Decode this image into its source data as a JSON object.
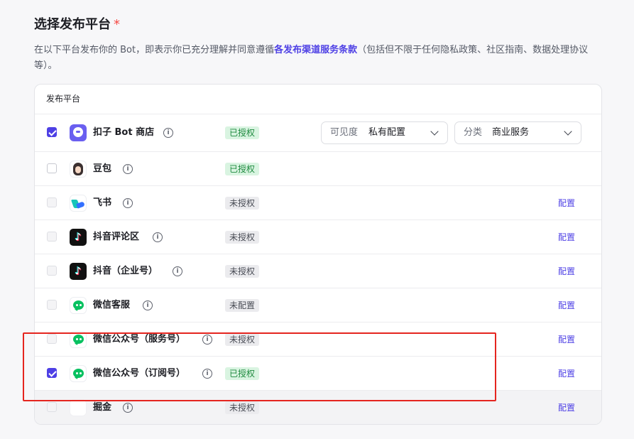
{
  "title": "选择发布平台",
  "required_mark": "*",
  "description": {
    "before": "在以下平台发布你的 Bot，即表示你已充分理解并同意遵循",
    "link": "各发布渠道服务条款",
    "after": "（包括但不限于任何隐私政策、社区指南、数据处理协议等）。"
  },
  "table": {
    "header": "发布平台",
    "rows": [
      {
        "name": "扣子 Bot 商店",
        "logo": "kouzi-logo",
        "checked": true,
        "status": "已授权"
      },
      {
        "name": "豆包",
        "logo": "doubao-logo",
        "checked": false,
        "status": "已授权"
      },
      {
        "name": "飞书",
        "logo": "feishu-logo",
        "checked": false,
        "status": "未授权",
        "action": "配置"
      },
      {
        "name": "抖音评论区",
        "logo": "douyin-logo",
        "checked": false,
        "status": "未授权",
        "action": "配置"
      },
      {
        "name": "抖音（企业号）",
        "logo": "douyin-logo",
        "checked": false,
        "status": "未授权",
        "action": "配置"
      },
      {
        "name": "微信客服",
        "logo": "wechat-logo",
        "checked": false,
        "status": "未配置",
        "action": "配置"
      },
      {
        "name": "微信公众号（服务号）",
        "logo": "wechat-logo",
        "checked": false,
        "status": "未授权",
        "action": "配置"
      },
      {
        "name": "微信公众号（订阅号）",
        "logo": "wechat-logo",
        "checked": true,
        "status": "已授权",
        "action": "配置"
      },
      {
        "name": "掘金",
        "logo": "juejin-logo",
        "checked": false,
        "status": "未授权",
        "action": "配置"
      }
    ]
  },
  "visibility_select": {
    "label": "可见度",
    "value": "私有配置"
  },
  "category_select": {
    "label": "分类",
    "value": "商业服务"
  },
  "info_glyph": "i",
  "douyin_glyph": "♪",
  "colors": {
    "accent": "#4e40e5",
    "authorized_bg": "#d9f4e1",
    "authorized_text": "#1f8a3f",
    "highlight_border": "#e5251f"
  }
}
